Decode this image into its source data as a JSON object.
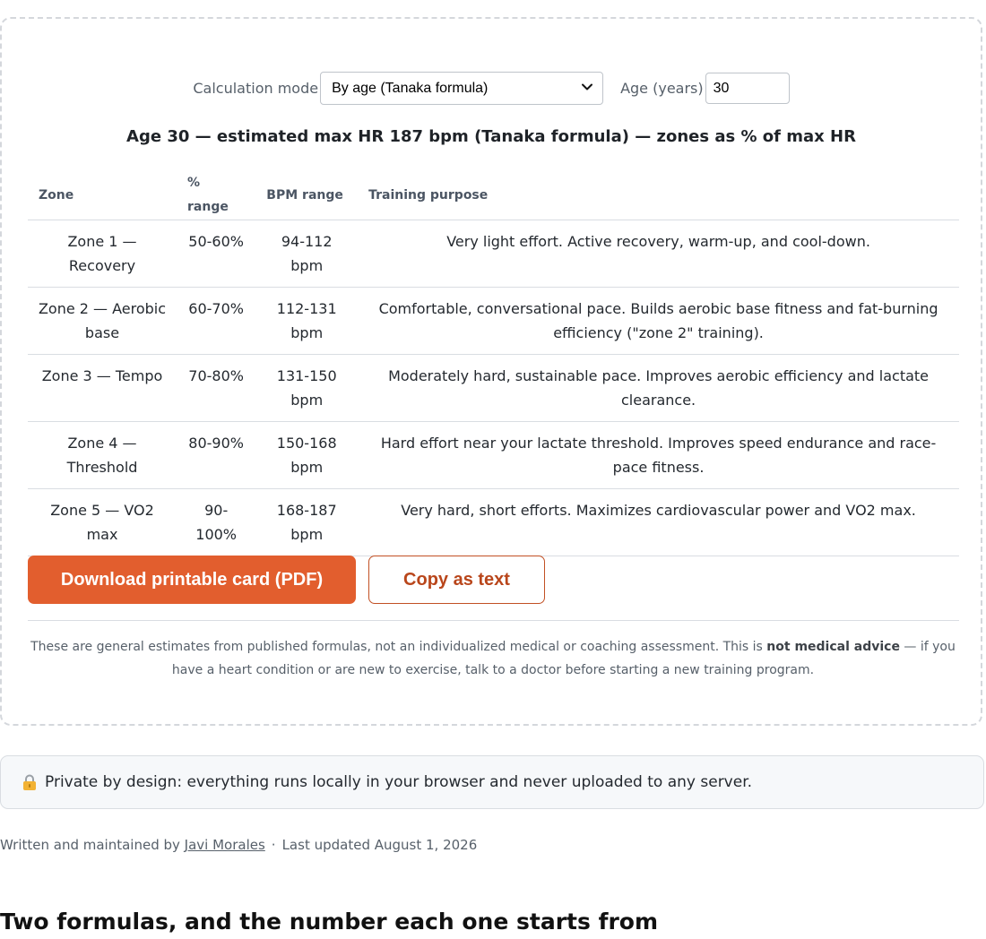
{
  "controls": {
    "mode_label": "Calculation mode",
    "mode_value": "By age (Tanaka formula)",
    "age_label": "Age (years)",
    "age_value": "30"
  },
  "summary": "Age 30 — estimated max HR 187 bpm (Tanaka formula) — zones as % of max HR",
  "table": {
    "headers": [
      "Zone",
      "% range",
      "BPM range",
      "Training purpose"
    ],
    "rows": [
      {
        "zone": "Zone 1 — Recovery",
        "pct": "50-60%",
        "bpm": "94-112 bpm",
        "purpose": "Very light effort. Active recovery, warm-up, and cool-down."
      },
      {
        "zone": "Zone 2 — Aerobic base",
        "pct": "60-70%",
        "bpm": "112-131 bpm",
        "purpose": "Comfortable, conversational pace. Builds aerobic base fitness and fat-burning efficiency (\"zone 2\" training)."
      },
      {
        "zone": "Zone 3 — Tempo",
        "pct": "70-80%",
        "bpm": "131-150 bpm",
        "purpose": "Moderately hard, sustainable pace. Improves aerobic efficiency and lactate clearance."
      },
      {
        "zone": "Zone 4 — Threshold",
        "pct": "80-90%",
        "bpm": "150-168 bpm",
        "purpose": "Hard effort near your lactate threshold. Improves speed endurance and race-pace fitness."
      },
      {
        "zone": "Zone 5 — VO2 max",
        "pct": "90-100%",
        "bpm": "168-187 bpm",
        "purpose": "Very hard, short efforts. Maximizes cardiovascular power and VO2 max."
      }
    ]
  },
  "buttons": {
    "download": "Download printable card (PDF)",
    "copy": "Copy as text"
  },
  "disclaimer": {
    "before": "These are general estimates from published formulas, not an individualized medical or coaching assessment. This is ",
    "bold": "not medical advice",
    "after": " — if you have a heart condition or are new to exercise, talk to a doctor before starting a new training program."
  },
  "privacy": {
    "icon": "lock-icon",
    "text": "Private by design: everything runs locally in your browser and never uploaded to any server."
  },
  "byline": {
    "prefix": "Written and maintained by",
    "author": "Javi Morales",
    "separator": "·",
    "updated": "Last updated August 1, 2026"
  },
  "section_heading": "Two formulas, and the number each one starts from",
  "colors": {
    "accent": "#e25e2e",
    "accent_text": "#b9461b",
    "border": "#d9dde2"
  }
}
